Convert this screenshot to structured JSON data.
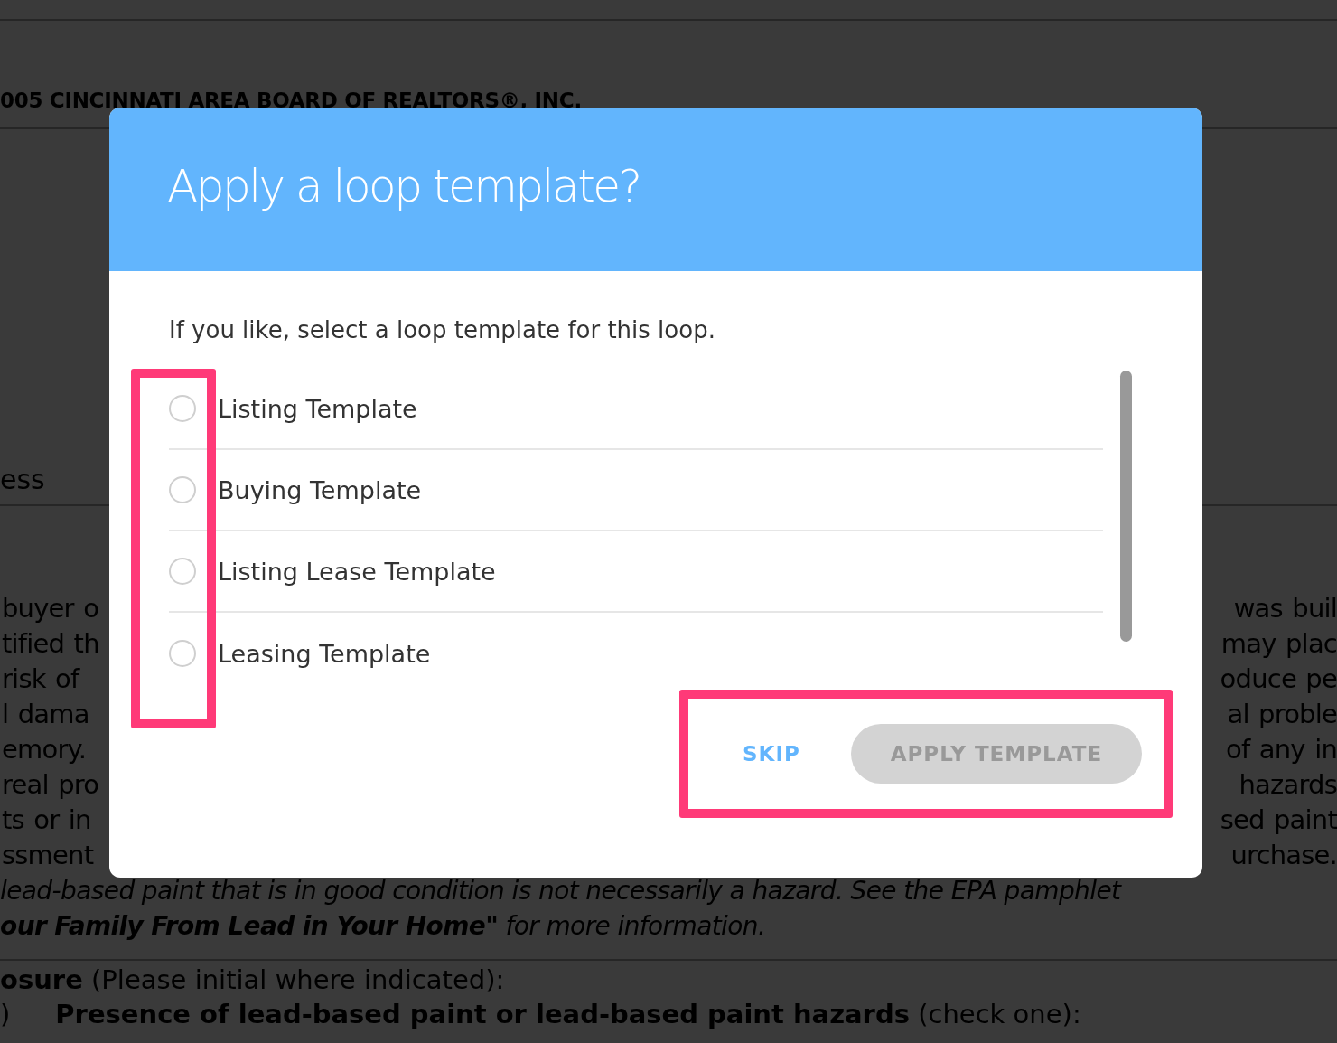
{
  "document": {
    "header": "005  CINCINNATI AREA BOARD OF REALTORS®, INC.",
    "field_label": "ess",
    "paragraph_lines": [
      {
        "left": "buyer o",
        "right": "was buil"
      },
      {
        "left": "tified th",
        "right": "may plac"
      },
      {
        "left": "risk of",
        "right": "oduce pe"
      },
      {
        "left": "l dama",
        "right": "al proble"
      },
      {
        "left": "emory.",
        "right": "of any in"
      },
      {
        "left": "real pro",
        "right": "hazards"
      },
      {
        "left": "ts or in",
        "right": "sed paint"
      },
      {
        "left": "ssment",
        "right": "urchase."
      }
    ],
    "note_lines": [
      "lead-based paint that is in good condition is not necessarily a hazard.  See the EPA pamphlet",
      "**our Family From Lead in Your Home\"** for more information."
    ],
    "disclosure_heading": "**osure** (Please initial where indicated):",
    "disclosure_item": {
      "number": ")",
      "text": "**Presence of lead-based paint or lead-based paint hazards** (check one):"
    }
  },
  "dialog": {
    "title": "Apply a loop template?",
    "prompt": "If you like, select a loop template for this loop.",
    "options_highlighted": true,
    "options": [
      {
        "label": "Listing Template",
        "selected": false
      },
      {
        "label": "Buying Template",
        "selected": false
      },
      {
        "label": "Listing Lease Template",
        "selected": false
      },
      {
        "label": "Leasing Template",
        "selected": false
      }
    ],
    "actions_highlighted": true,
    "actions": [
      {
        "kind": "text",
        "label": "SKIP",
        "disabled": false
      },
      {
        "kind": "pill",
        "label": "APPLY TEMPLATE",
        "disabled": true
      }
    ]
  }
}
